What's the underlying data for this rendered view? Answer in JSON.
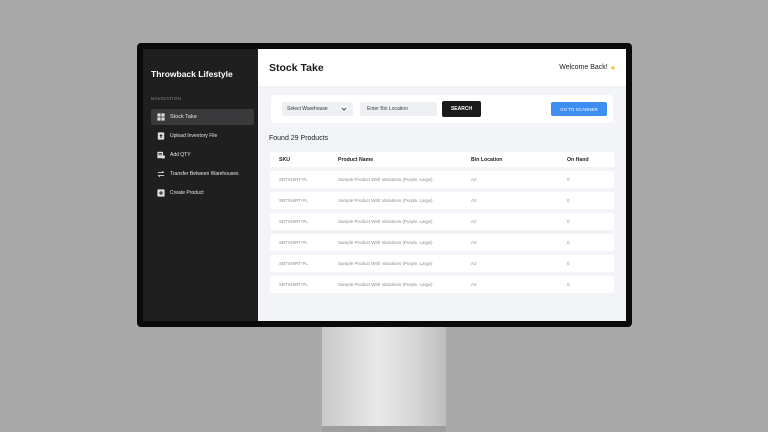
{
  "app": {
    "brand": "Throwback Lifestyle"
  },
  "sidebar": {
    "caption": "NAVIGATION",
    "items": [
      {
        "label": "Stock Take",
        "icon": "grid-icon",
        "active": true
      },
      {
        "label": "Upload Inventory File",
        "icon": "upload-file-icon",
        "active": false
      },
      {
        "label": "Add QTY",
        "icon": "add-qty-icon",
        "active": false
      },
      {
        "label": "Transfer Between Warehouses",
        "icon": "transfer-icon",
        "active": false
      },
      {
        "label": "Create Product",
        "icon": "plus-square-icon",
        "active": false
      }
    ]
  },
  "header": {
    "title": "Stock Take",
    "welcome": "Welcome Back!",
    "welcome_icon": "star-icon"
  },
  "filters": {
    "warehouse_select": "Select Warehouse",
    "bin_placeholder": "Enter Bin Location",
    "search_label": "SEARCH",
    "scanner_label": "GO TO SCANNER"
  },
  "results": {
    "summary": "Found 29 Products"
  },
  "table": {
    "columns": [
      "SKU",
      "Product Name",
      "Bin Location",
      "On Hand"
    ],
    "rows": [
      [
        "SBTSHIRT-PL",
        "Sample Product With Variations (Purple, Large)",
        "A2",
        "0"
      ],
      [
        "SBTSHIRT-PL",
        "Sample Product With Variations (Purple, Large)",
        "A2",
        "0"
      ],
      [
        "SBTSHIRT-PL",
        "Sample Product With Variations (Purple, Large)",
        "A2",
        "0"
      ],
      [
        "SBTSHIRT-PL",
        "Sample Product With Variations (Purple, Large)",
        "A2",
        "0"
      ],
      [
        "SBTSHIRT-PL",
        "Sample Product With Variations (Purple, Large)",
        "A2",
        "0"
      ],
      [
        "SBTSHIRT-PL",
        "Sample Product With Variations (Purple, Large)",
        "A2",
        "0"
      ]
    ]
  },
  "colors": {
    "accent": "#3d8ef0",
    "sidebar": "#1f1f20",
    "search_button": "#1a1a1a"
  }
}
